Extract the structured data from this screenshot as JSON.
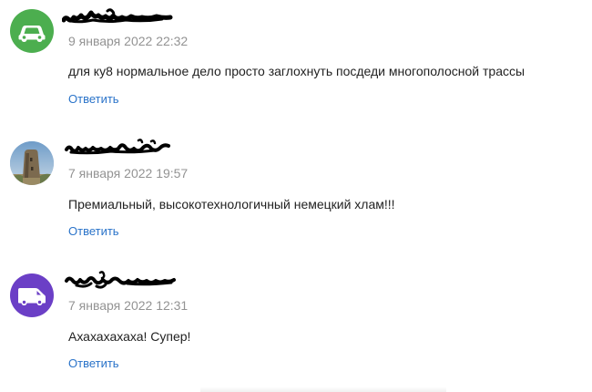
{
  "comments": [
    {
      "author": "",
      "avatar_icon": "car-icon",
      "avatar_color": "#4cae4f",
      "date": "9 января 2022 22:32",
      "text": "для ку8 нормальное дело просто заглохнуть посдеди многополосной трассы",
      "reply_label": "Ответить"
    },
    {
      "author": "",
      "avatar_icon": "tower-photo-icon",
      "avatar_color": "#7ea4c4",
      "date": "7 января 2022 19:57",
      "text": "Премиальный, высокотехнологичный немецкий хлам!!!",
      "reply_label": "Ответить"
    },
    {
      "author": "",
      "avatar_icon": "van-icon",
      "avatar_color": "#6b3fc6",
      "date": "7 января 2022 12:31",
      "text": "Ахахахахаха! Супер!",
      "reply_label": "Ответить"
    }
  ],
  "colors": {
    "date": "#939393",
    "text": "#222222",
    "link": "#2a73c9"
  }
}
